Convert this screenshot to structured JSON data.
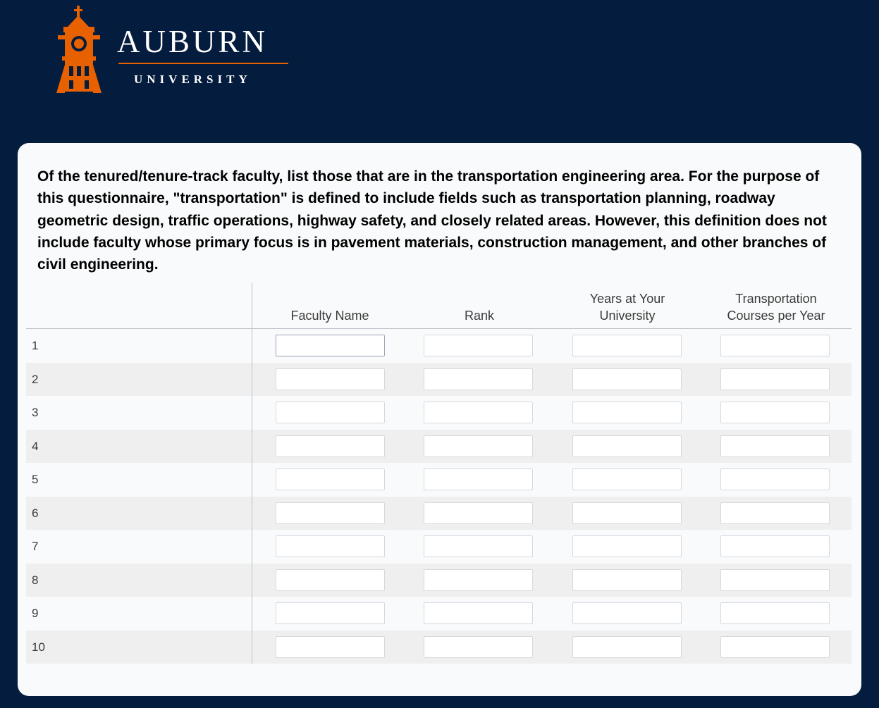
{
  "branding": {
    "logo_word": "AUBURN",
    "logo_sub": "UNIVERSITY",
    "colors": {
      "navy": "#041c3d",
      "orange": "#e86100"
    }
  },
  "question": {
    "text": "Of the tenured/tenure-track faculty, list those that are in the transportation engineering area. For the purpose of this questionnaire, \"transportation\" is defined to include fields such as transportation planning, roadway geometric design, traffic operations, highway safety, and closely related areas. However, this definition does not include faculty whose primary focus is in pavement materials, construction management, and other branches of civil engineering."
  },
  "table": {
    "columns": [
      {
        "label": "Faculty Name"
      },
      {
        "label": "Rank"
      },
      {
        "label": "Years at Your University"
      },
      {
        "label": "Transportation Courses per Year"
      }
    ],
    "rows": [
      {
        "label": "1",
        "values": [
          "",
          "",
          "",
          ""
        ]
      },
      {
        "label": "2",
        "values": [
          "",
          "",
          "",
          ""
        ]
      },
      {
        "label": "3",
        "values": [
          "",
          "",
          "",
          ""
        ]
      },
      {
        "label": "4",
        "values": [
          "",
          "",
          "",
          ""
        ]
      },
      {
        "label": "5",
        "values": [
          "",
          "",
          "",
          ""
        ]
      },
      {
        "label": "6",
        "values": [
          "",
          "",
          "",
          ""
        ]
      },
      {
        "label": "7",
        "values": [
          "",
          "",
          "",
          ""
        ]
      },
      {
        "label": "8",
        "values": [
          "",
          "",
          "",
          ""
        ]
      },
      {
        "label": "9",
        "values": [
          "",
          "",
          "",
          ""
        ]
      },
      {
        "label": "10",
        "values": [
          "",
          "",
          "",
          ""
        ]
      }
    ]
  }
}
